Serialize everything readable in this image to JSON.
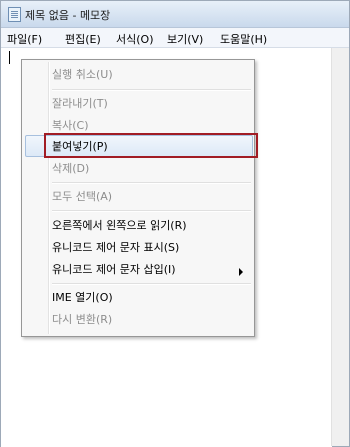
{
  "window": {
    "title": "제목 없음 - 메모장",
    "icon": "notepad-icon"
  },
  "menubar": {
    "items": [
      {
        "label": "파일(F)"
      },
      {
        "label": "편집(E)"
      },
      {
        "label": "서식(O)"
      },
      {
        "label": "보기(V)"
      },
      {
        "label": "도움말(H)"
      }
    ]
  },
  "context_menu": {
    "items": [
      {
        "label": "실행 취소(U)",
        "enabled": false
      },
      {
        "label": "잘라내기(T)",
        "enabled": false
      },
      {
        "label": "복사(C)",
        "enabled": false
      },
      {
        "label": "붙여넣기(P)",
        "enabled": true,
        "highlighted": true
      },
      {
        "label": "삭제(D)",
        "enabled": false
      },
      {
        "label": "모두 선택(A)",
        "enabled": false
      },
      {
        "label": "오른쪽에서 왼쪽으로 읽기(R)",
        "enabled": true
      },
      {
        "label": "유니코드 제어 문자 표시(S)",
        "enabled": true
      },
      {
        "label": "유니코드 제어 문자 삽입(I)",
        "enabled": true,
        "submenu_icon": "chevron-right-icon"
      },
      {
        "label": "IME 열기(O)",
        "enabled": true
      },
      {
        "label": "다시 변환(R)",
        "enabled": false
      }
    ]
  },
  "colors": {
    "annotation": "#a11c24",
    "disabled_text": "#8d8d8d"
  }
}
